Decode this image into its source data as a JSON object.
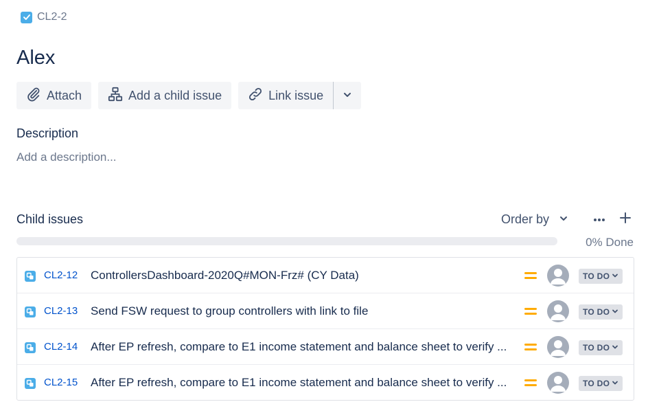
{
  "breadcrumb": {
    "issue_key": "CL2-2",
    "type_icon": "task-checkbox-icon"
  },
  "issue": {
    "title": "Alex"
  },
  "toolbar": {
    "attach_label": "Attach",
    "add_child_label": "Add a child issue",
    "link_issue_label": "Link issue"
  },
  "description": {
    "label": "Description",
    "placeholder": "Add a description..."
  },
  "child_issues": {
    "label": "Child issues",
    "order_by_label": "Order by",
    "progress_percent": 0,
    "progress_text": "0% Done",
    "items": [
      {
        "key": "CL2-12",
        "summary": "ControllersDashboard-2020Q#MON-Frz# (CY Data)",
        "priority": "medium",
        "status": "TO DO"
      },
      {
        "key": "CL2-13",
        "summary": "Send FSW request to group controllers with link to file",
        "priority": "medium",
        "status": "TO DO"
      },
      {
        "key": "CL2-14",
        "summary": "After EP refresh, compare to E1 income statement and balance sheet to verify ...",
        "priority": "medium",
        "status": "TO DO"
      },
      {
        "key": "CL2-15",
        "summary": "After EP refresh, compare to E1 income statement and balance sheet to verify ...",
        "priority": "medium",
        "status": "TO DO"
      }
    ]
  },
  "colors": {
    "link": "#0052cc",
    "subtask_icon": "#4bade8",
    "priority_medium": "#ffab00",
    "status_bg": "#dfe1e6"
  }
}
